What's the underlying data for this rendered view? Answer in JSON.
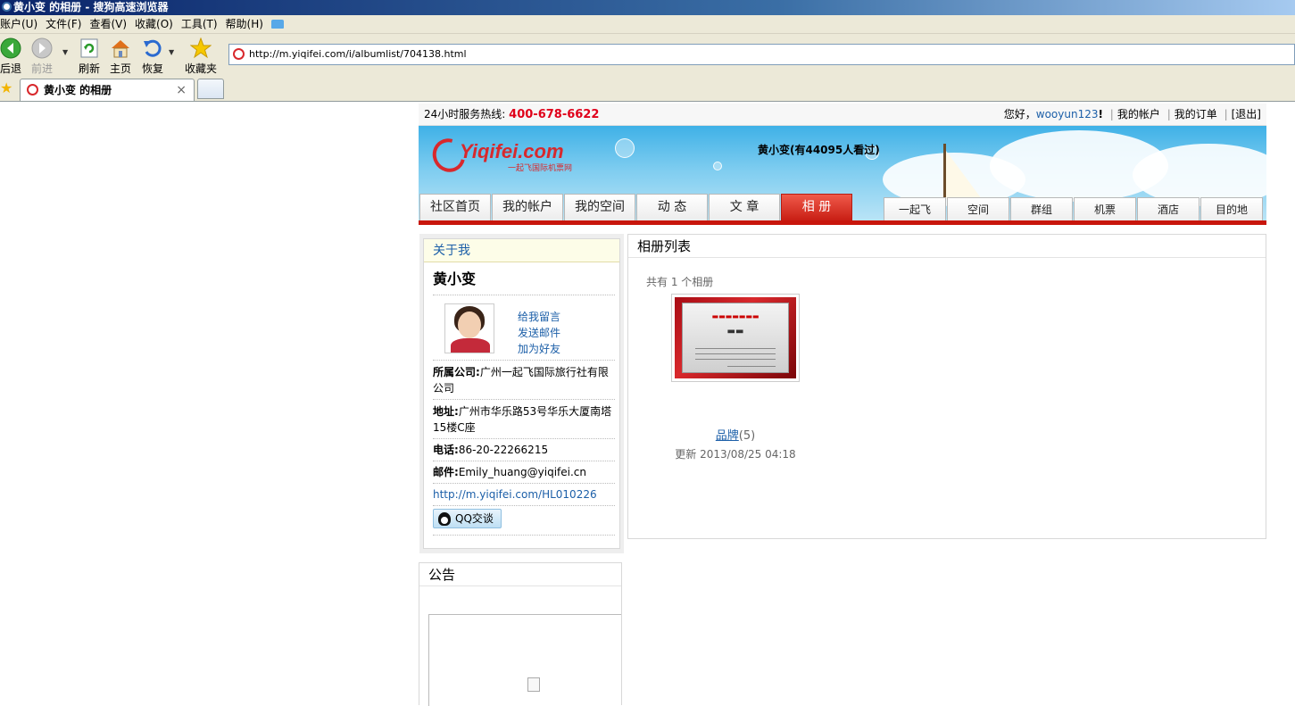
{
  "browser": {
    "title": "黄小变 的相册 - 搜狗高速浏览器",
    "menu": [
      "账户(U)",
      "文件(F)",
      "查看(V)",
      "收藏(O)",
      "工具(T)",
      "帮助(H)"
    ],
    "toolbar": {
      "back": "后退",
      "forward": "前进",
      "refresh": "刷新",
      "home": "主页",
      "restore": "恢复",
      "favorites": "收藏夹"
    },
    "address": "http://m.yiqifei.com/i/albumlist/704138.html",
    "tab_title": "黄小变 的相册",
    "tab_close": "×"
  },
  "site": {
    "hotline_label": "24小时服务热线:",
    "hotline_number": "400-678-6622",
    "greeting": "您好，",
    "username": "wooyun123",
    "exclaim": "!",
    "account_link": "我的帐户",
    "orders_link": "我的订单",
    "logout_link": "[退出]",
    "logo_text": "Yiqifei.com",
    "logo_sub": "一起飞国际机票网",
    "visits": "黄小变(有44095人看过)",
    "nav": [
      "社区首页",
      "我的帐户",
      "我的空间",
      "动 态",
      "文 章",
      "相 册"
    ],
    "subnav": [
      "一起飞",
      "空间",
      "群组",
      "机票",
      "酒店",
      "目的地"
    ]
  },
  "about": {
    "heading": "关于我",
    "name": "黄小变",
    "actions": [
      "给我留言",
      "发送邮件",
      "加为好友"
    ],
    "company_label": "所属公司:",
    "company_value": "广州一起飞国际旅行社有限公司",
    "address_label": "地址:",
    "address_value": "广州市华乐路53号华乐大厦南塔15楼C座",
    "phone_label": "电话:",
    "phone_value": "86-20-22266215",
    "email_label": "邮件:",
    "email_value": "Emily_huang@yiqifei.cn",
    "homepage": "http://m.yiqifei.com/HL010226",
    "qq_button": "QQ交谈"
  },
  "notice": {
    "heading": "公告"
  },
  "albums": {
    "heading": "相册列表",
    "count_text": "共有 1 个相册",
    "items": [
      {
        "name": "品牌",
        "count": "(5)",
        "updated": "更新 2013/08/25 04:18"
      }
    ]
  }
}
